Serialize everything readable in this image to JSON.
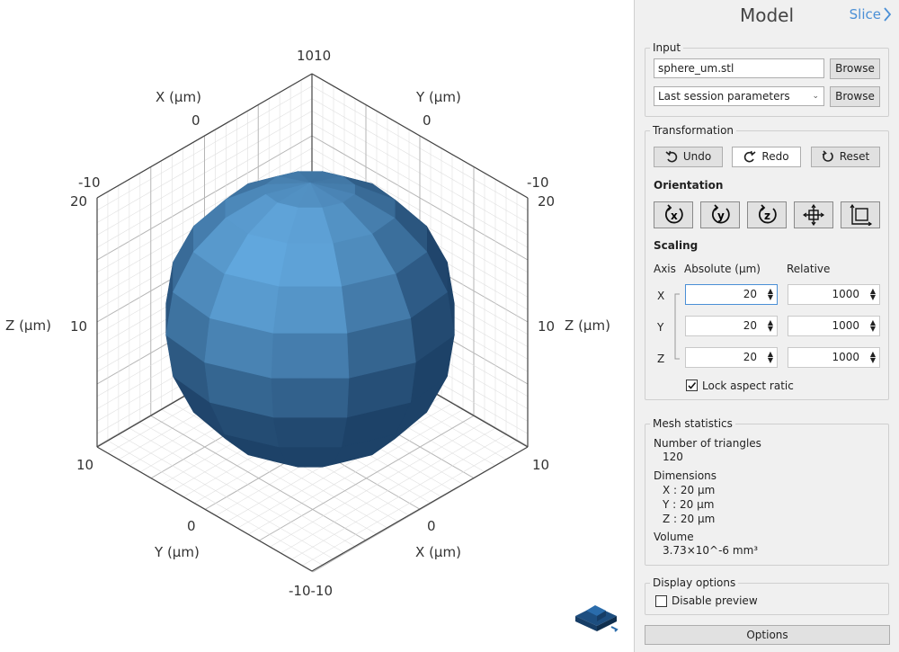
{
  "viewport": {
    "axis_name_unit": "(µm)",
    "axes": {
      "x": "X",
      "y": "Y",
      "z": "Z"
    },
    "ticks": {
      "top_corner": "1010",
      "upper_left_zero": "0",
      "upper_right_zero": "0",
      "left_m10": "-10",
      "right_m10": "-10",
      "left_20": "20",
      "right_20": "20",
      "left_10_mid": "10",
      "right_10_mid": "10",
      "left_10_low": "10",
      "right_10_low": "10",
      "lower_left_zero": "0",
      "lower_right_zero": "0",
      "bottom_corner": "-10-10"
    },
    "model_color": "#2f76b8",
    "tray_icon": "printer-icon"
  },
  "panel": {
    "title": "Model",
    "nav_next": "Slice",
    "input": {
      "group_label": "Input",
      "file_value": "sphere_um.stl",
      "browse_label": "Browse",
      "params_value": "Last session parameters",
      "browse2_label": "Browse"
    },
    "transformation": {
      "group_label": "Transformation",
      "undo": "Undo",
      "redo": "Redo",
      "reset": "Reset",
      "orientation_label": "Orientation",
      "orientation_icons": [
        "rotate-x-icon",
        "rotate-y-icon",
        "rotate-z-icon",
        "center-icon",
        "align-corner-icon"
      ],
      "scaling_label": "Scaling",
      "col_axis": "Axis",
      "col_absolute": "Absolute (µm)",
      "col_relative": "Relative",
      "rows": [
        {
          "axis": "X",
          "absolute": "20",
          "relative": "1000"
        },
        {
          "axis": "Y",
          "absolute": "20",
          "relative": "1000"
        },
        {
          "axis": "Z",
          "absolute": "20",
          "relative": "1000"
        }
      ],
      "lock_label": "Lock aspect ratic",
      "lock_checked": true
    },
    "mesh": {
      "group_label": "Mesh statistics",
      "triangles_label": "Number of triangles",
      "triangles_value": "120",
      "dims_label": "Dimensions",
      "dim_x": "X : 20 µm",
      "dim_y": "Y : 20 µm",
      "dim_z": "Z : 20 µm",
      "volume_label": "Volume",
      "volume_value": "3.73×10^-6 mm³"
    },
    "display": {
      "group_label": "Display options",
      "disable_preview": "Disable preview",
      "disable_preview_checked": false
    },
    "options_label": "Options"
  }
}
